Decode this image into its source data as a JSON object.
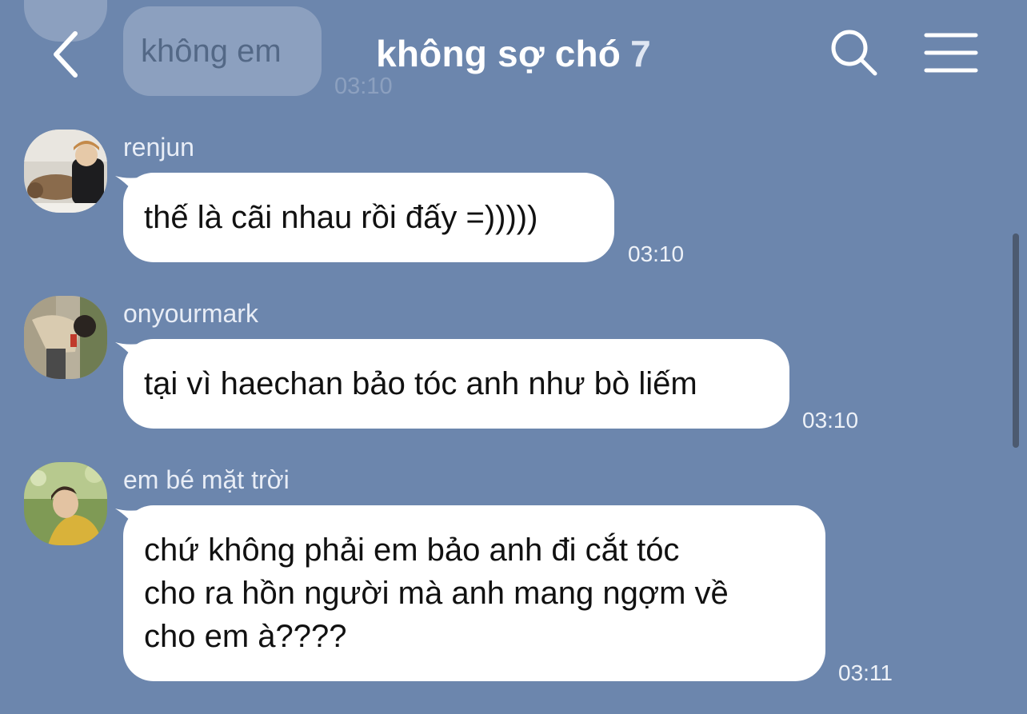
{
  "background_color": "#6c86ad",
  "ghost_message": {
    "text": "không em",
    "time": "03:10"
  },
  "header": {
    "title": "không sợ chó",
    "member_count": "7",
    "back_icon": "chevron-left-icon",
    "search_icon": "search-icon",
    "menu_icon": "hamburger-menu-icon"
  },
  "messages": [
    {
      "sender": "renjun",
      "text": "thế là cãi nhau rồi đấy =)))))",
      "time": "03:10",
      "avatar": "avatar-photo-with-dog"
    },
    {
      "sender": "onyourmark",
      "text": "tại vì haechan bảo tóc anh như bò liếm",
      "time": "03:10",
      "avatar": "avatar-photo-person-bending"
    },
    {
      "sender": "em bé mặt trời",
      "text": "chứ không phải em bảo anh đi cắt tóc\ncho ra hồn người mà anh mang ngợm về\ncho em à????",
      "time": "03:11",
      "avatar": "avatar-photo-person-looking-up"
    }
  ]
}
